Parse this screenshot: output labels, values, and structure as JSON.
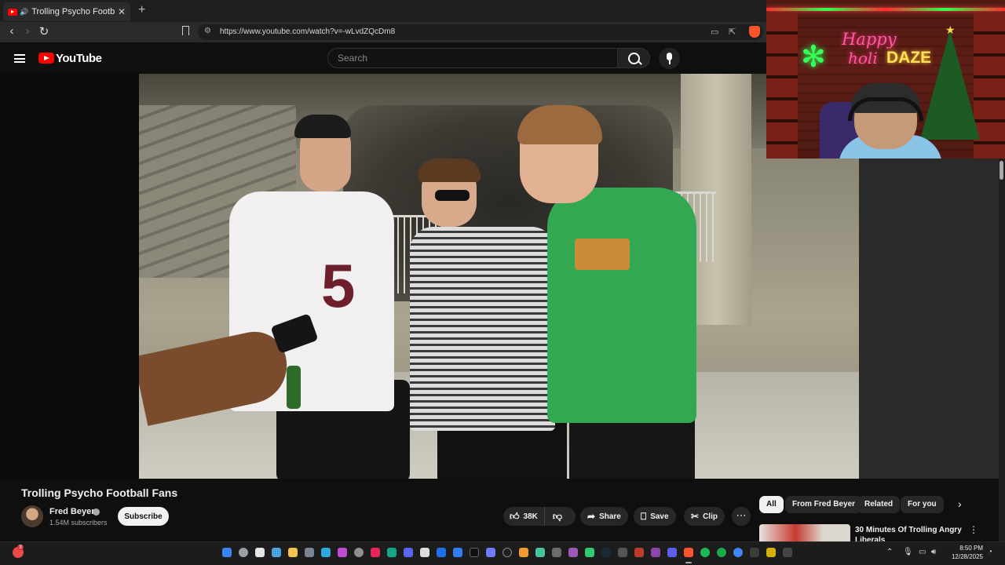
{
  "browser": {
    "tab_title": "Trolling Psycho Football Fans",
    "url": "https://www.youtube.com/watch?v=-wLvdZQcDm8"
  },
  "youtube": {
    "logo_text": "YouTube",
    "search_placeholder": "Search"
  },
  "video": {
    "title": "Trolling Psycho Football Fans",
    "channel_name": "Fred Beyer",
    "subscribers": "1.54M subscribers",
    "subscribe_label": "Subscribe",
    "likes": "38K",
    "share_label": "Share",
    "save_label": "Save",
    "clip_label": "Clip",
    "jersey_number": "5"
  },
  "stream_overlay": {
    "line1": "Happy",
    "line2": "holi",
    "line3": "DAZE"
  },
  "chips": [
    "All",
    "From Fred Beyer",
    "Related",
    "For you"
  ],
  "recommendation": {
    "title": "30 Minutes Of Trolling Angry Liberals"
  },
  "taskbar": {
    "notification_count": "3",
    "time": "8:50 PM",
    "date": "12/28/2025"
  },
  "colors": {
    "youtube_red": "#ff0000",
    "background": "#0f0f0f",
    "shirt_green": "#33a852"
  }
}
